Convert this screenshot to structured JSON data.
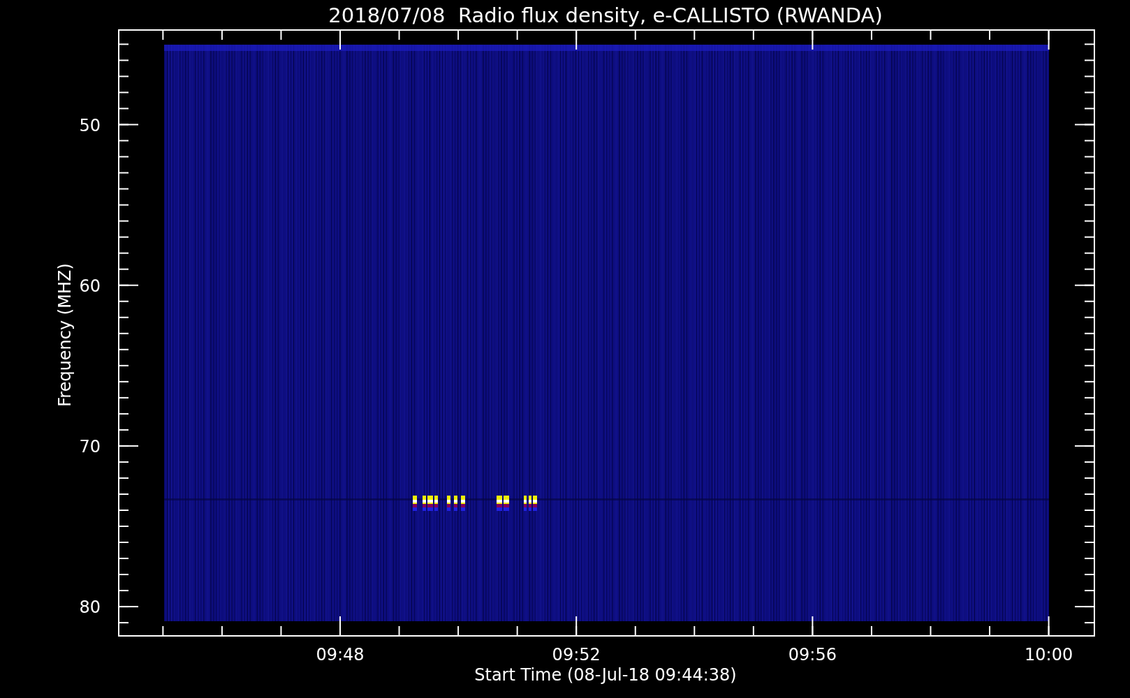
{
  "title": "2018/07/08  Radio flux density, e-CALLISTO (RWANDA)",
  "ylabel": "Frequency (MHZ)",
  "xlabel": "Start Time (08-Jul-18 09:44:38)",
  "yticks": [
    "50",
    "60",
    "70",
    "80"
  ],
  "xticks": [
    "09:48",
    "09:52",
    "09:56",
    "10:00"
  ]
}
